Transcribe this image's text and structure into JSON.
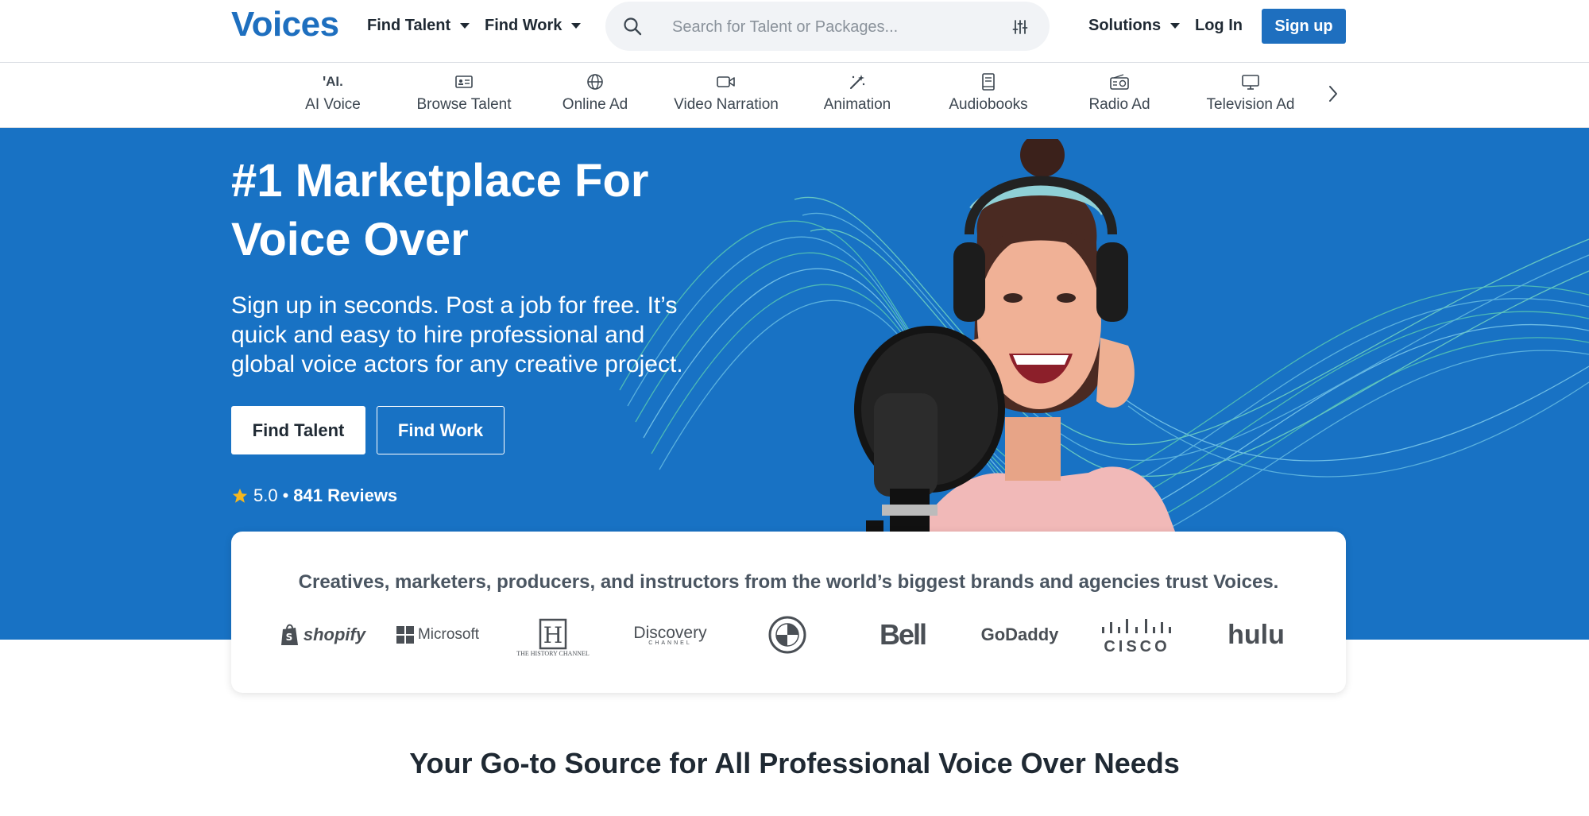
{
  "nav": {
    "logo": "Voices",
    "find_talent": "Find Talent",
    "find_work": "Find Work",
    "search_placeholder": "Search for Talent or Packages...",
    "solutions": "Solutions",
    "login": "Log In",
    "signup": "Sign up"
  },
  "categories": [
    {
      "label": "AI Voice",
      "icon": "ai-icon"
    },
    {
      "label": "Browse Talent",
      "icon": "id-card-icon"
    },
    {
      "label": "Online Ad",
      "icon": "globe-icon"
    },
    {
      "label": "Video Narration",
      "icon": "video-camera-icon"
    },
    {
      "label": "Animation",
      "icon": "magic-wand-icon"
    },
    {
      "label": "Audiobooks",
      "icon": "book-icon"
    },
    {
      "label": "Radio Ad",
      "icon": "radio-icon"
    },
    {
      "label": "Television Ad",
      "icon": "monitor-icon"
    }
  ],
  "hero": {
    "title": "#1 Marketplace For Voice Over",
    "subtitle": "Sign up in seconds. Post a job for free. It’s quick and easy to hire professional and global voice actors for any creative project.",
    "find_talent": "Find Talent",
    "find_work": "Find Work",
    "rating": "5.0",
    "separator": "•",
    "reviews": "841 Reviews"
  },
  "trust": {
    "text": "Creatives, marketers, producers, and instructors from the world’s biggest brands and agencies trust Voices.",
    "brands": [
      "shopify",
      "Microsoft",
      "THE HISTORY CHANNEL",
      "Discovery",
      "CHANNEL",
      "Bell",
      "GoDaddy",
      "CISCO",
      "hulu"
    ]
  },
  "section_title": "Your Go-to Source for All Professional Voice Over Needs",
  "colors": {
    "brand_blue": "#1e6fbf",
    "hero_blue": "#1872c4",
    "star": "#f5b71f"
  }
}
